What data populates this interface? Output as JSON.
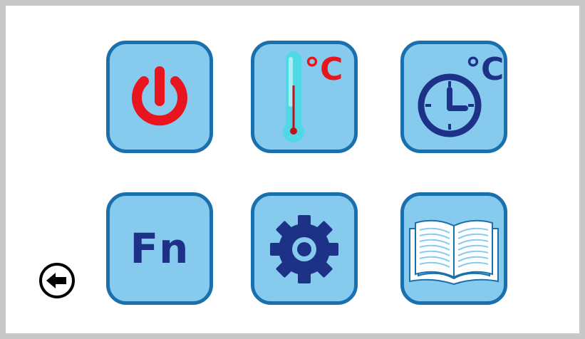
{
  "colors": {
    "tile_fill": "#86cbee",
    "tile_border": "#1a6fad",
    "icon_navy": "#1d3287",
    "icon_red": "#e8151e",
    "thermo_fill": "#4fd8e6",
    "frame": "#c8c8c8"
  },
  "tiles": [
    {
      "icon": "power-icon"
    },
    {
      "icon": "thermometer-icon",
      "label": "°C"
    },
    {
      "icon": "clock-icon",
      "label": "°C"
    },
    {
      "icon": "fn-icon",
      "label": "Fn"
    },
    {
      "icon": "gear-icon"
    },
    {
      "icon": "book-icon"
    }
  ],
  "back": {
    "icon": "back-arrow-icon"
  }
}
